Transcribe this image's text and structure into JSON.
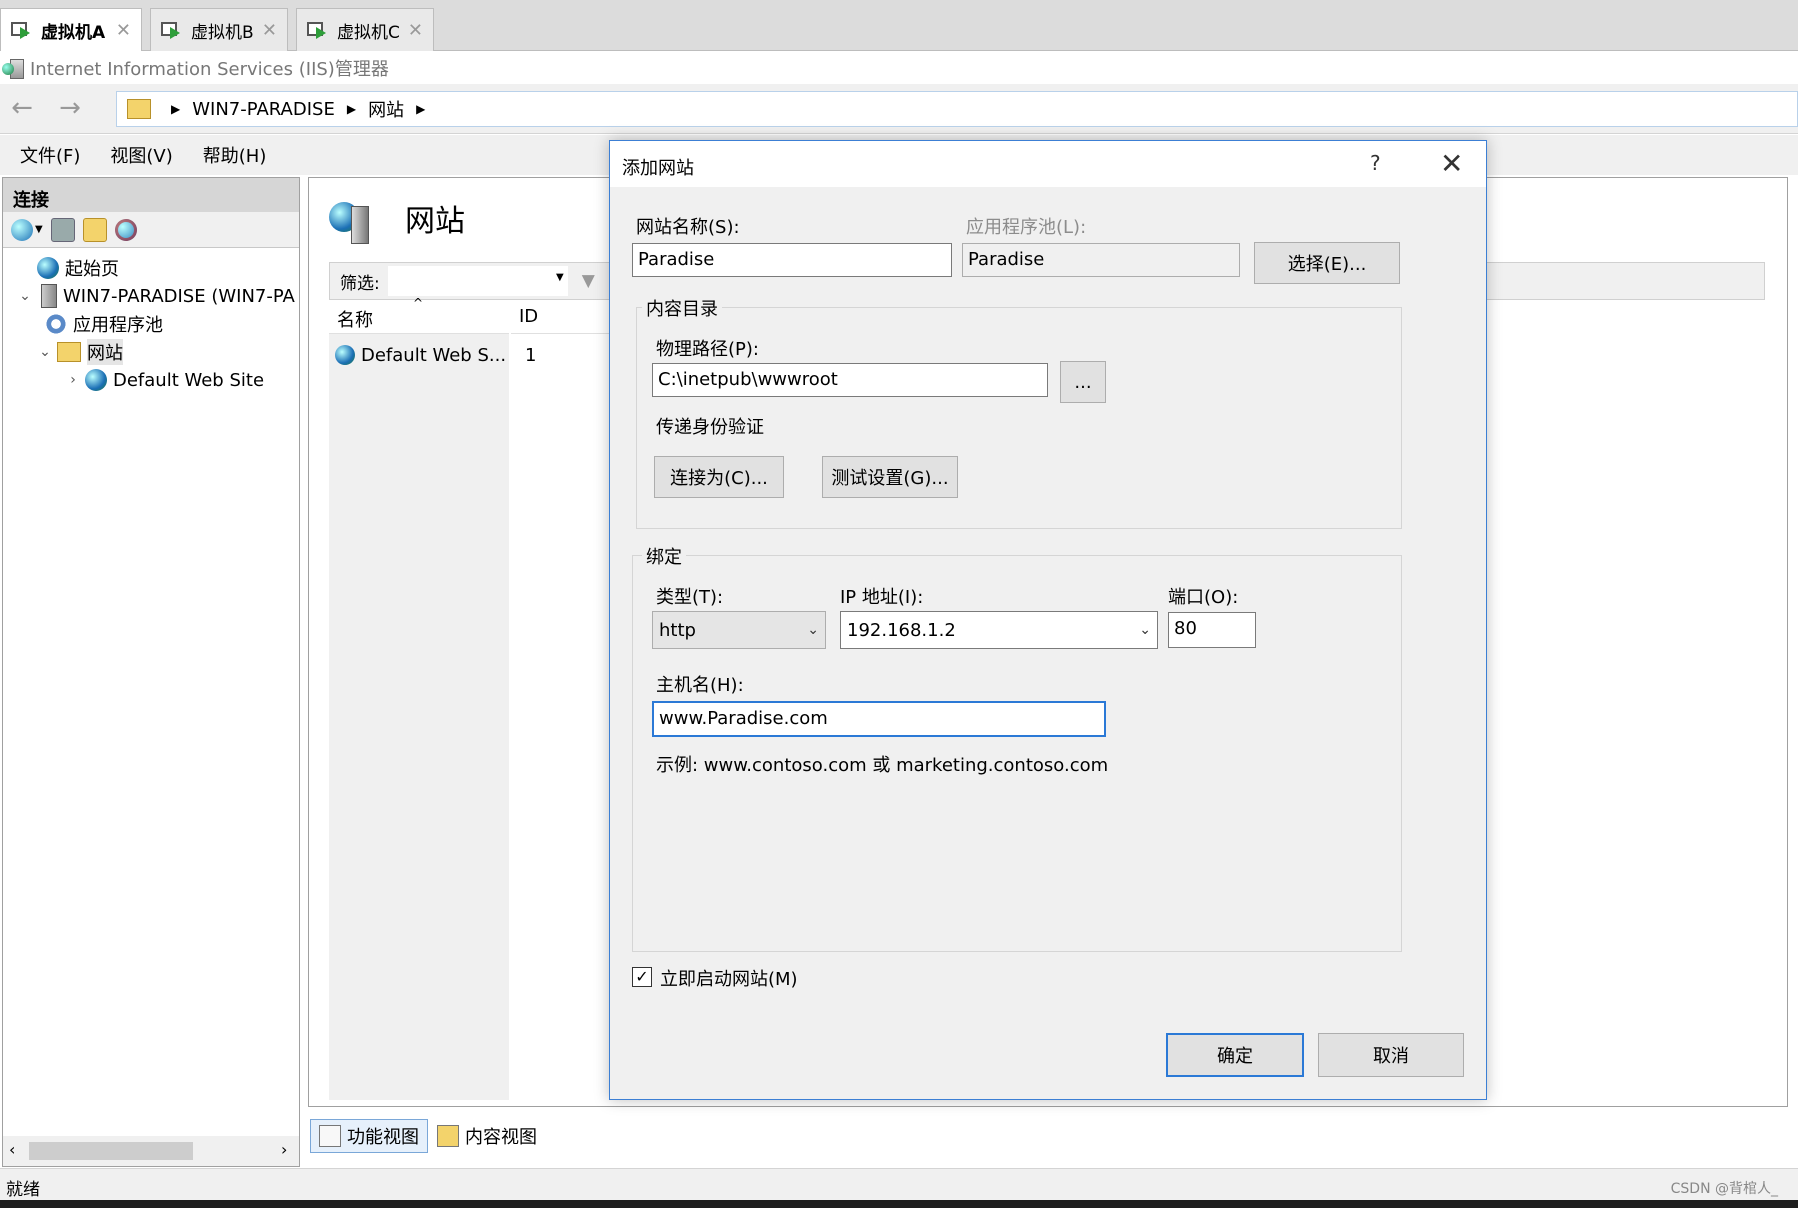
{
  "vm_tabs": [
    {
      "label": "虚拟机A",
      "close": "✕"
    },
    {
      "label": "虚拟机B",
      "close": "✕"
    },
    {
      "label": "虚拟机C",
      "close": "✕"
    }
  ],
  "app_title": "Internet Information Services (IIS)管理器",
  "breadcrumb": {
    "server": "WIN7-PARADISE",
    "node": "网站"
  },
  "menu": {
    "file": "文件(F)",
    "view": "视图(V)",
    "help": "帮助(H)"
  },
  "connections": {
    "header": "连接",
    "tree": {
      "start_page": "起始页",
      "server": "WIN7-PARADISE (WIN7-PA",
      "app_pools": "应用程序池",
      "sites": "网站",
      "default_site": "Default Web Site"
    }
  },
  "main": {
    "title": "网站",
    "filter_label": "筛选:",
    "col_name": "名称",
    "col_id": "ID",
    "rows": [
      {
        "name": "Default Web S...",
        "id": "1"
      }
    ],
    "tab_features": "功能视图",
    "tab_content": "内容视图"
  },
  "status": "就绪",
  "watermark": "CSDN @背棺人_",
  "dialog": {
    "title": "添加网站",
    "help": "?",
    "site_name_label": "网站名称(S):",
    "site_name_value": "Paradise",
    "app_pool_label": "应用程序池(L):",
    "app_pool_value": "Paradise",
    "select_button": "选择(E)...",
    "content_group": "内容目录",
    "physical_path_label": "物理路径(P):",
    "physical_path_value": "C:\\inetpub\\wwwroot",
    "browse_button": "...",
    "passthrough_label": "传递身份验证",
    "connect_as_button": "连接为(C)...",
    "test_settings_button": "测试设置(G)...",
    "binding_group": "绑定",
    "type_label": "类型(T):",
    "type_value": "http",
    "ip_label": "IP 地址(I):",
    "ip_value": "192.168.1.2",
    "port_label": "端口(O):",
    "port_value": "80",
    "host_label": "主机名(H):",
    "host_value": "www.Paradise.com",
    "example_text": "示例: www.contoso.com 或 marketing.contoso.com",
    "start_immediately_label": "立即启动网站(M)",
    "start_immediately_checked": true,
    "ok_button": "确定",
    "cancel_button": "取消"
  }
}
